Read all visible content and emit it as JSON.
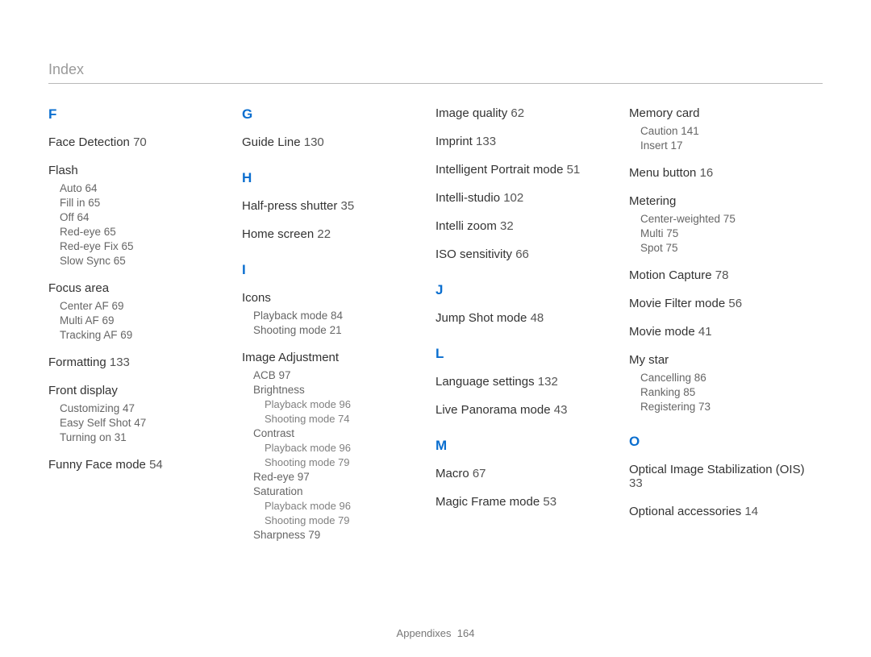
{
  "header": {
    "title": "Index"
  },
  "footer": {
    "section": "Appendixes",
    "page": "164"
  },
  "cols": [
    {
      "blocks": [
        {
          "type": "letter",
          "text": "F"
        },
        {
          "type": "entry",
          "label": "Face Detection",
          "page": "70"
        },
        {
          "type": "group",
          "label": "Flash",
          "subs": [
            {
              "label": "Auto",
              "page": "64"
            },
            {
              "label": "Fill in",
              "page": "65"
            },
            {
              "label": "Off",
              "page": "64"
            },
            {
              "label": "Red-eye",
              "page": "65"
            },
            {
              "label": "Red-eye Fix",
              "page": "65"
            },
            {
              "label": "Slow Sync",
              "page": "65"
            }
          ]
        },
        {
          "type": "group",
          "label": "Focus area",
          "subs": [
            {
              "label": "Center AF",
              "page": "69"
            },
            {
              "label": "Multi AF",
              "page": "69"
            },
            {
              "label": "Tracking AF",
              "page": "69"
            }
          ]
        },
        {
          "type": "entry",
          "label": "Formatting",
          "page": "133"
        },
        {
          "type": "group",
          "label": "Front display",
          "subs": [
            {
              "label": "Customizing",
              "page": "47"
            },
            {
              "label": "Easy Self Shot",
              "page": "47"
            },
            {
              "label": "Turning on",
              "page": "31"
            }
          ]
        },
        {
          "type": "entry",
          "label": "Funny Face mode",
          "page": "54"
        }
      ]
    },
    {
      "blocks": [
        {
          "type": "letter",
          "text": "G"
        },
        {
          "type": "entry",
          "label": "Guide Line",
          "page": "130"
        },
        {
          "type": "letter",
          "text": "H"
        },
        {
          "type": "entry",
          "label": "Half-press shutter",
          "page": "35"
        },
        {
          "type": "entry",
          "label": "Home screen",
          "page": "22"
        },
        {
          "type": "letter",
          "text": "I"
        },
        {
          "type": "group",
          "label": "Icons",
          "subs": [
            {
              "label": "Playback mode",
              "page": "84"
            },
            {
              "label": "Shooting mode",
              "page": "21"
            }
          ]
        },
        {
          "type": "group",
          "label": "Image Adjustment",
          "subs": [
            {
              "label": "ACB",
              "page": "97"
            },
            {
              "label": "Brightness",
              "subs": [
                {
                  "label": "Playback mode",
                  "page": "96"
                },
                {
                  "label": "Shooting mode",
                  "page": "74"
                }
              ]
            },
            {
              "label": "Contrast",
              "subs": [
                {
                  "label": "Playback mode",
                  "page": "96"
                },
                {
                  "label": "Shooting mode",
                  "page": "79"
                }
              ]
            },
            {
              "label": "Red-eye",
              "page": "97"
            },
            {
              "label": "Saturation",
              "subs": [
                {
                  "label": "Playback mode",
                  "page": "96"
                },
                {
                  "label": "Shooting mode",
                  "page": "79"
                }
              ]
            },
            {
              "label": "Sharpness",
              "page": "79"
            }
          ]
        }
      ]
    },
    {
      "blocks": [
        {
          "type": "entry",
          "label": "Image quality",
          "page": "62"
        },
        {
          "type": "entry",
          "label": "Imprint",
          "page": "133"
        },
        {
          "type": "entry",
          "label": "Intelligent Portrait mode",
          "page": "51"
        },
        {
          "type": "entry",
          "label": "Intelli-studio",
          "page": "102"
        },
        {
          "type": "entry",
          "label": "Intelli zoom",
          "page": "32"
        },
        {
          "type": "entry",
          "label": "ISO sensitivity",
          "page": "66"
        },
        {
          "type": "letter",
          "text": "J"
        },
        {
          "type": "entry",
          "label": "Jump Shot mode",
          "page": "48"
        },
        {
          "type": "letter",
          "text": "L"
        },
        {
          "type": "entry",
          "label": "Language settings",
          "page": "132"
        },
        {
          "type": "entry",
          "label": "Live Panorama mode",
          "page": "43"
        },
        {
          "type": "letter",
          "text": "M"
        },
        {
          "type": "entry",
          "label": "Macro",
          "page": "67"
        },
        {
          "type": "entry",
          "label": "Magic Frame mode",
          "page": "53"
        }
      ]
    },
    {
      "blocks": [
        {
          "type": "group",
          "label": "Memory card",
          "subs": [
            {
              "label": "Caution",
              "page": "141"
            },
            {
              "label": "Insert",
              "page": "17"
            }
          ]
        },
        {
          "type": "entry",
          "label": "Menu button",
          "page": "16"
        },
        {
          "type": "group",
          "label": "Metering",
          "subs": [
            {
              "label": "Center-weighted",
              "page": "75"
            },
            {
              "label": "Multi",
              "page": "75"
            },
            {
              "label": "Spot",
              "page": "75"
            }
          ]
        },
        {
          "type": "entry",
          "label": "Motion Capture",
          "page": "78"
        },
        {
          "type": "entry",
          "label": "Movie Filter mode",
          "page": "56"
        },
        {
          "type": "entry",
          "label": "Movie mode",
          "page": "41"
        },
        {
          "type": "group",
          "label": "My star",
          "subs": [
            {
              "label": "Cancelling",
              "page": "86"
            },
            {
              "label": "Ranking",
              "page": "85"
            },
            {
              "label": "Registering",
              "page": "73"
            }
          ]
        },
        {
          "type": "letter",
          "text": "O"
        },
        {
          "type": "entry",
          "label": "Optical Image Stabilization (OIS)",
          "page": "33"
        },
        {
          "type": "entry",
          "label": "Optional accessories",
          "page": "14"
        }
      ]
    }
  ]
}
